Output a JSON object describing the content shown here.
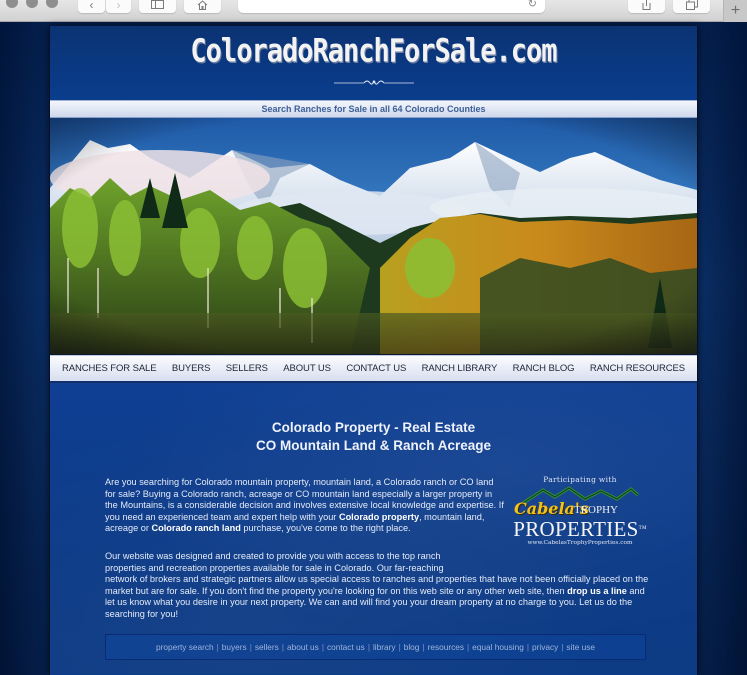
{
  "browser": {
    "nav_back_icon": "chevron-left-icon",
    "nav_forward_icon": "chevron-right-icon",
    "sidebar_icon": "sidebar-icon",
    "home_icon": "home-icon",
    "reload_icon": "reload-icon",
    "share_icon": "share-icon",
    "tabs_icon": "tabs-icon",
    "new_tab_icon": "plus-icon",
    "url": ""
  },
  "site": {
    "logo": "ColoradoRanchForSale.com",
    "search_strip": "Search Ranches for Sale in all 64 Colorado Counties",
    "hero_alt": "Colorado mountains with autumn aspen forest",
    "nav": [
      {
        "label": "RANCHES FOR SALE"
      },
      {
        "label": "BUYERS"
      },
      {
        "label": "SELLERS"
      },
      {
        "label": "ABOUT US"
      },
      {
        "label": "CONTACT US"
      },
      {
        "label": "RANCH LIBRARY"
      },
      {
        "label": "RANCH BLOG"
      },
      {
        "label": "RANCH RESOURCES"
      }
    ],
    "headline_1": "Colorado Property - Real Estate",
    "headline_2": "CO Mountain Land & Ranch Acreage",
    "intro": {
      "part1": "Are you searching for Colorado mountain property, mountain land, a Colorado ranch or CO land for sale? Buying a Colorado ranch, acreage or CO mountain land especially a larger property in the Mountains, is a considerable decision and involves extensive local knowledge and expertise. If you need an experienced team and expert help with your ",
      "bold1": "Colorado property",
      "part2": ", mountain land, acreage or ",
      "bold2": "Colorado ranch land",
      "part3": " purchase, you've come to the right place."
    },
    "para2": {
      "line1": "Our website was designed and created to provide you with access to the top ranch",
      "line2": "properties and recreation properties available for sale in Colorado. Our far-reaching",
      "part1": "network of brokers and strategic partners allow us special access to ranches and properties that have not been officially placed on the market but are for sale. If you don't find the property you're looking for on this web site or any other web site, then ",
      "link": "drop us a line",
      "part2": " and let us know what you desire in your next property. We can and will find you your dream property at no charge to you. Let us do the searching for you!"
    },
    "partner": {
      "participating": "Participating with",
      "brand_script": "Cabela's",
      "brand_trophy": "TROPHY",
      "brand_properties": "PROPERTIES",
      "tm": "TM",
      "url": "www.CabelasTrophyProperties.com"
    },
    "footer_links": [
      {
        "label": "property search"
      },
      {
        "label": "buyers"
      },
      {
        "label": "sellers"
      },
      {
        "label": "about us"
      },
      {
        "label": "contact us"
      },
      {
        "label": "library"
      },
      {
        "label": "blog"
      },
      {
        "label": "resources"
      },
      {
        "label": "equal housing"
      },
      {
        "label": "privacy"
      },
      {
        "label": "site use"
      }
    ],
    "footer_separator": "|"
  }
}
